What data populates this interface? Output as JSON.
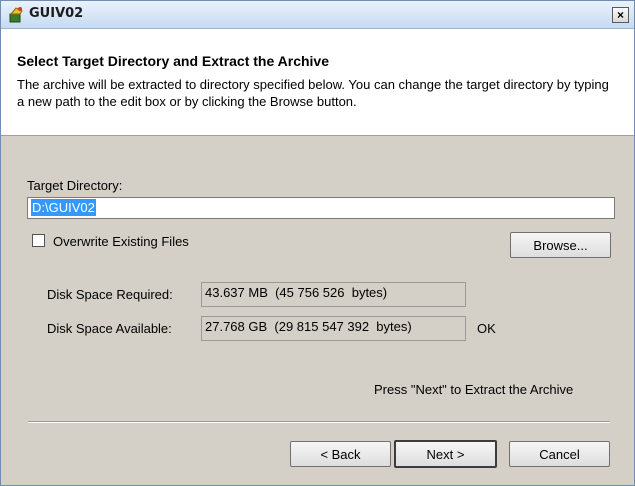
{
  "window": {
    "title": "GUIV02",
    "close_label": "×"
  },
  "header": {
    "title": "Select Target Directory and Extract the Archive",
    "description": "The archive will be extracted to directory specified below. You can change the target directory by typing a new path to the edit box or by clicking the Browse button."
  },
  "target": {
    "label": "Target Directory:",
    "value": "D:\\GUIV02"
  },
  "overwrite": {
    "label": "Overwrite Existing Files",
    "checked": false
  },
  "buttons": {
    "browse": "Browse...",
    "back": "< Back",
    "next": "Next >",
    "cancel": "Cancel"
  },
  "disk": {
    "required_label": "Disk Space Required:",
    "required_value": "43.637 MB  (45 756 526  bytes)",
    "available_label": "Disk Space Available:",
    "available_value": "27.768 GB  (29 815 547 392  bytes)",
    "status": "OK"
  },
  "hint": "Press \"Next\" to Extract the Archive",
  "colors": {
    "selection": "#3399ff",
    "dialog_bg": "#d4d0c8"
  }
}
